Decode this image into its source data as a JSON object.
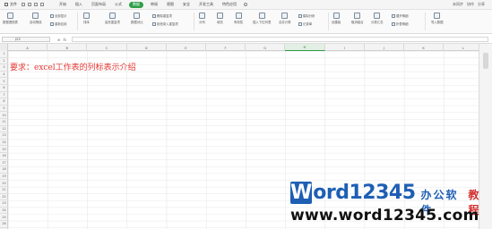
{
  "menubar": {
    "file_label": "文件",
    "tabs": [
      {
        "label": "开始",
        "active": false
      },
      {
        "label": "插入",
        "active": false
      },
      {
        "label": "页面布局",
        "active": false
      },
      {
        "label": "公式",
        "active": false
      },
      {
        "label": "数据",
        "active": true
      },
      {
        "label": "审阅",
        "active": false
      },
      {
        "label": "视图",
        "active": false
      },
      {
        "label": "安全",
        "active": false
      },
      {
        "label": "开发工具",
        "active": false
      },
      {
        "label": "特色应用",
        "active": false
      }
    ],
    "search_icon": "search-icon",
    "right_items": [
      "未同步",
      "协作",
      "分享"
    ]
  },
  "ribbon": {
    "big_buttons": [
      {
        "label": "数据透视表",
        "icon": "pivot-icon"
      },
      {
        "label": "自动筛选",
        "icon": "filter-icon"
      },
      {
        "label": "排序",
        "icon": "sort-icon"
      },
      {
        "label": "高亮重复项",
        "icon": "highlight-icon"
      },
      {
        "label": "数据对比",
        "icon": "compare-icon"
      },
      {
        "label": "分列",
        "icon": "split-icon"
      },
      {
        "label": "填充",
        "icon": "fill-icon"
      },
      {
        "label": "有效性",
        "icon": "validity-icon"
      },
      {
        "label": "插入下拉列表",
        "icon": "dropdown-icon"
      },
      {
        "label": "合并计算",
        "icon": "consolidate-icon"
      },
      {
        "label": "模拟分析",
        "icon": "whatif-icon"
      },
      {
        "label": "创建组",
        "icon": "group-icon"
      },
      {
        "label": "取消组合",
        "icon": "ungroup-icon"
      },
      {
        "label": "分类汇总",
        "icon": "subtotal-icon"
      },
      {
        "label": "导入数据",
        "icon": "import-icon"
      }
    ],
    "small_buttons": [
      {
        "label": "全部显示",
        "icon": "show-all-icon"
      },
      {
        "label": "重新应用",
        "icon": "reapply-icon"
      },
      {
        "label": "删除重复项",
        "icon": "delete-dup-icon"
      },
      {
        "label": "拒绝录入重复项",
        "icon": "reject-dup-icon"
      },
      {
        "label": "记录单",
        "icon": "record-icon"
      },
      {
        "label": "展开明细",
        "icon": "expand-icon"
      },
      {
        "label": "折叠明细",
        "icon": "collapse-icon"
      }
    ]
  },
  "formula_bar": {
    "name_box": "J23",
    "fx_symbol": "fx",
    "value": ""
  },
  "sheet": {
    "columns": [
      "A",
      "B",
      "C",
      "D",
      "E",
      "F",
      "G",
      "H",
      "I",
      "J",
      "K",
      "L"
    ],
    "selected_column": "H",
    "rows": [
      "1",
      "2",
      "3",
      "4",
      "5",
      "6",
      "7",
      "8",
      "9",
      "10",
      "11",
      "12",
      "13",
      "14",
      "15",
      "16",
      "17",
      "18",
      "19",
      "20",
      "21",
      "22",
      "23",
      "24",
      "25",
      "26"
    ],
    "a1_text": "要求：excel工作表的列标表示介绍"
  },
  "watermark": {
    "box_letter": "W",
    "brand": "ord12345",
    "tag1": "办公软件",
    "tag2": "教程",
    "url": "www.word12345.com"
  }
}
